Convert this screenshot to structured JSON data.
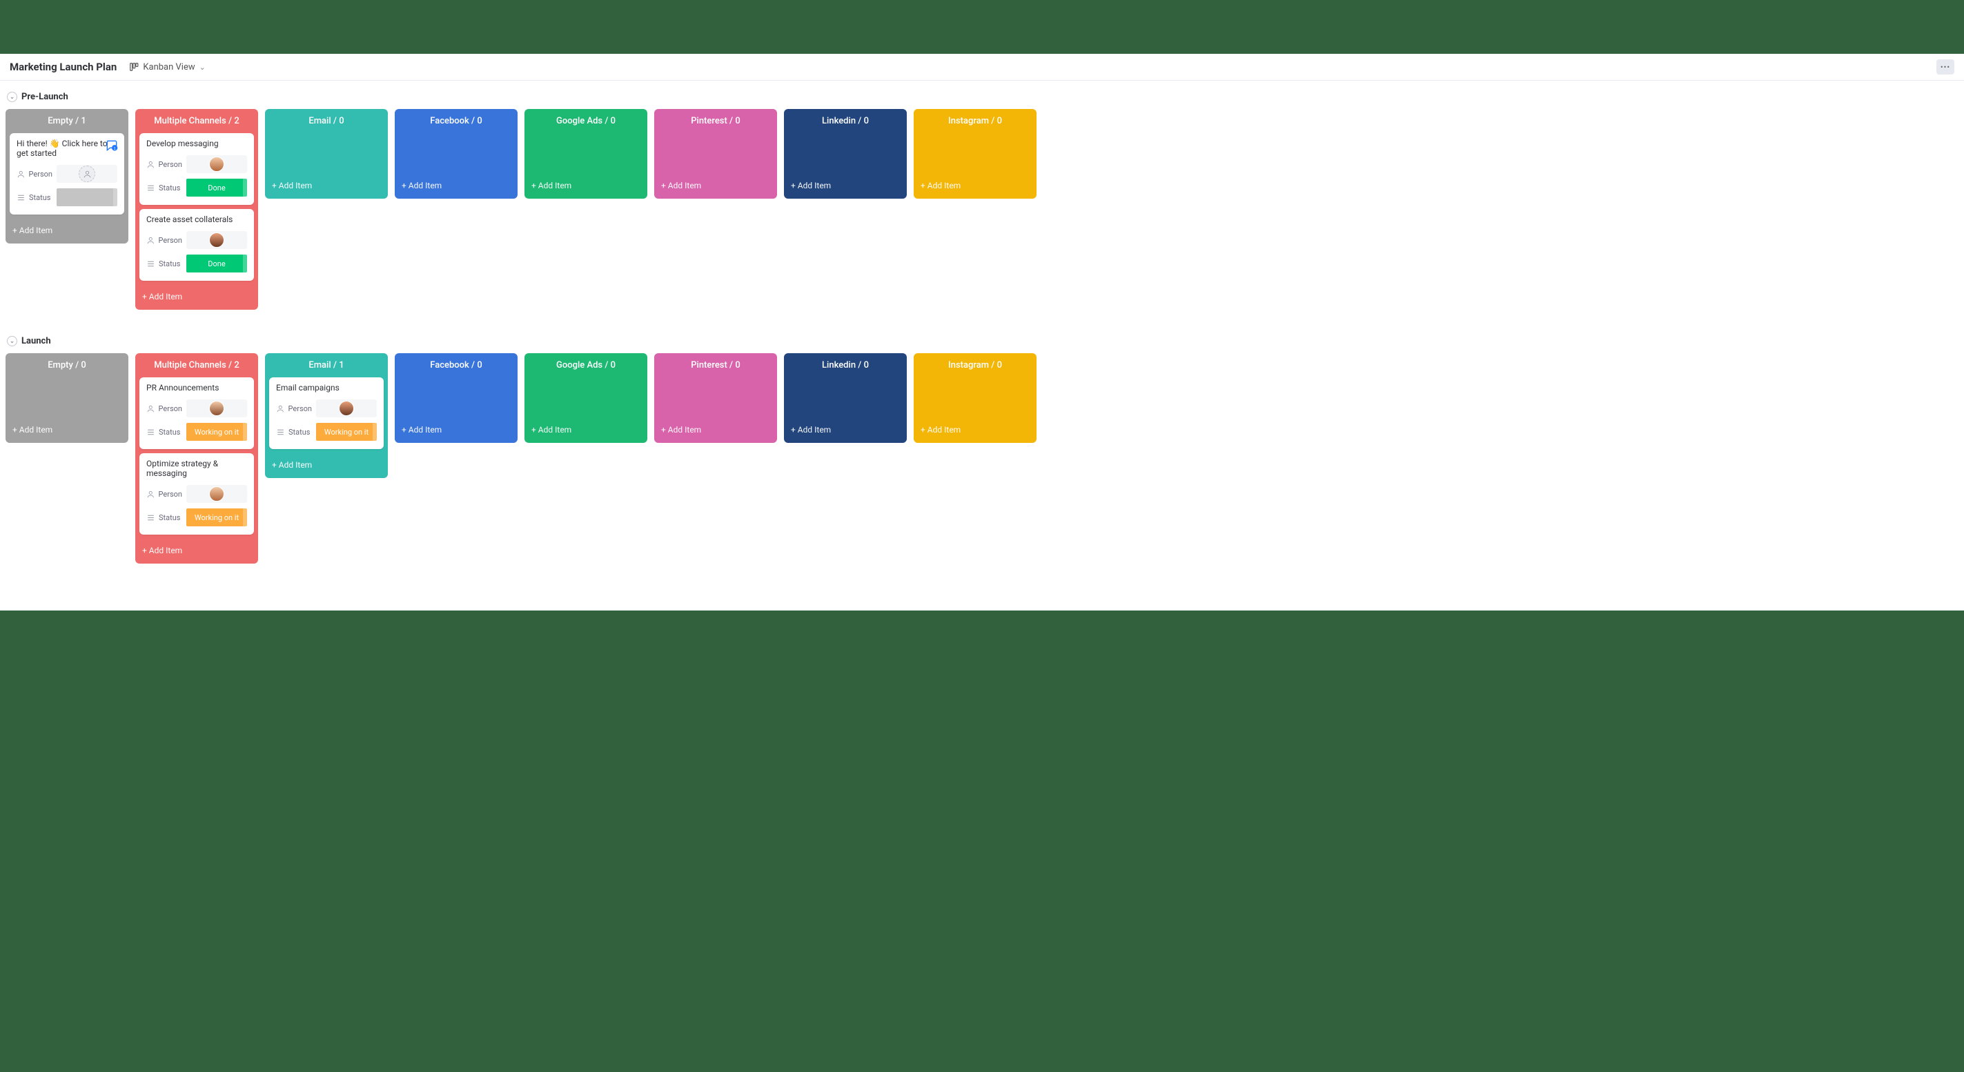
{
  "header": {
    "title": "Marketing Launch Plan",
    "view_label": "Kanban View",
    "more_label": "•••"
  },
  "add_item_label": "+ Add Item",
  "field_labels": {
    "person": "Person",
    "status": "Status"
  },
  "status_text": {
    "done": "Done",
    "working": "Working on it"
  },
  "column_defs": [
    {
      "key": "empty",
      "name": "Empty",
      "color": "c-grey"
    },
    {
      "key": "multi",
      "name": "Multiple Channels",
      "color": "c-red"
    },
    {
      "key": "email",
      "name": "Email",
      "color": "c-teal"
    },
    {
      "key": "facebook",
      "name": "Facebook",
      "color": "c-blue"
    },
    {
      "key": "gads",
      "name": "Google Ads",
      "color": "c-green"
    },
    {
      "key": "pinterest",
      "name": "Pinterest",
      "color": "c-pink"
    },
    {
      "key": "linkedin",
      "name": "Linkedin",
      "color": "c-navy"
    },
    {
      "key": "instagram",
      "name": "Instagram",
      "color": "c-yellow"
    }
  ],
  "groups": [
    {
      "title": "Pre-Launch",
      "columns": {
        "empty": {
          "count": 1,
          "cards": [
            {
              "title": "Hi there! 👋 Click here to get started",
              "person": null,
              "status": null,
              "chat": true
            }
          ]
        },
        "multi": {
          "count": 2,
          "cards": [
            {
              "title": "Develop messaging",
              "person": "a1",
              "status": "done"
            },
            {
              "title": "Create asset collaterals",
              "person": "a2",
              "status": "done"
            }
          ]
        },
        "email": {
          "count": 0,
          "cards": []
        },
        "facebook": {
          "count": 0,
          "cards": []
        },
        "gads": {
          "count": 0,
          "cards": []
        },
        "pinterest": {
          "count": 0,
          "cards": []
        },
        "linkedin": {
          "count": 0,
          "cards": []
        },
        "instagram": {
          "count": 0,
          "cards": []
        }
      }
    },
    {
      "title": "Launch",
      "columns": {
        "empty": {
          "count": 0,
          "cards": []
        },
        "multi": {
          "count": 2,
          "cards": [
            {
              "title": "PR Announcements",
              "person": "a3",
              "status": "working"
            },
            {
              "title": "Optimize strategy & messaging",
              "person": "a1",
              "status": "working"
            }
          ]
        },
        "email": {
          "count": 1,
          "cards": [
            {
              "title": "Email campaigns",
              "person": "a2",
              "status": "working"
            }
          ]
        },
        "facebook": {
          "count": 0,
          "cards": []
        },
        "gads": {
          "count": 0,
          "cards": []
        },
        "pinterest": {
          "count": 0,
          "cards": []
        },
        "linkedin": {
          "count": 0,
          "cards": []
        },
        "instagram": {
          "count": 0,
          "cards": []
        }
      }
    }
  ]
}
